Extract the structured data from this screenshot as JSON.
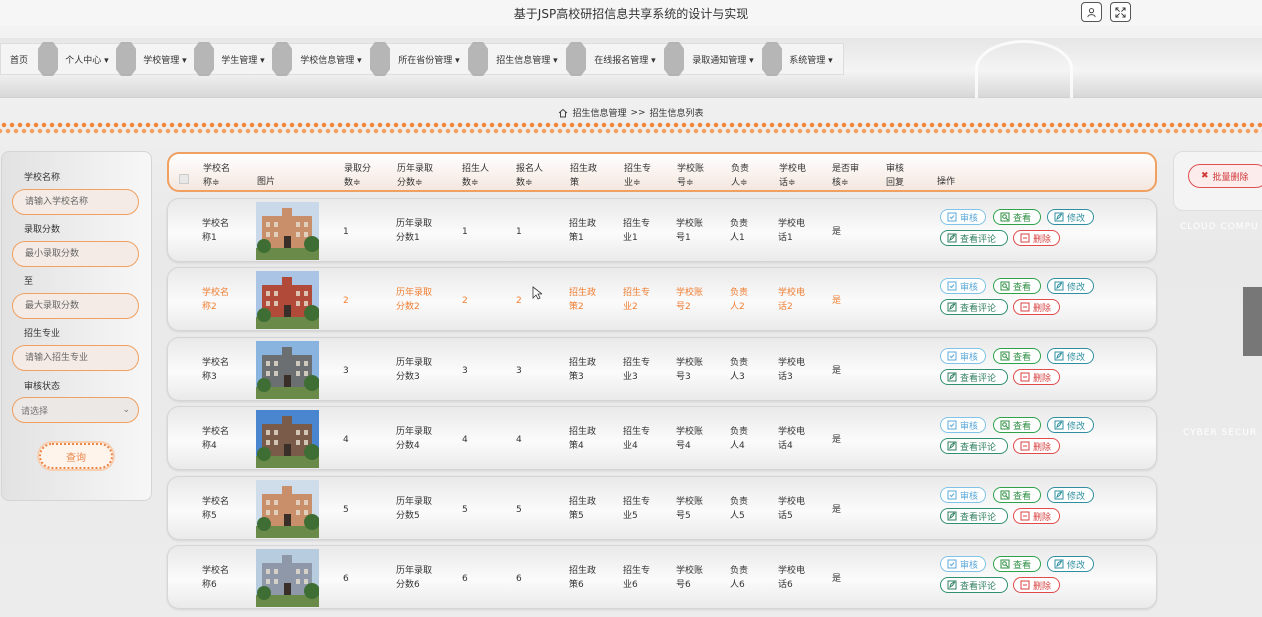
{
  "app": {
    "title": "基于JSP高校研招信息共享系统的设计与实现"
  },
  "nav": {
    "items": [
      {
        "label": "首页"
      },
      {
        "label": "个人中心 ▾"
      },
      {
        "label": "学校管理 ▾"
      },
      {
        "label": "学生管理 ▾"
      },
      {
        "label": "学校信息管理 ▾"
      },
      {
        "label": "所在省份管理 ▾"
      },
      {
        "label": "招生信息管理 ▾"
      },
      {
        "label": "在线报名管理 ▾"
      },
      {
        "label": "录取通知管理 ▾"
      },
      {
        "label": "系统管理 ▾"
      }
    ]
  },
  "breadcrumb": {
    "section": "招生信息管理",
    "sep": ">>",
    "page": "招生信息列表"
  },
  "search": {
    "school_label": "学校名称",
    "school_placeholder": "请输入学校名称",
    "score_label": "录取分数",
    "min_placeholder": "最小录取分数",
    "to_label": "至",
    "max_placeholder": "最大录取分数",
    "major_label": "招生专业",
    "major_placeholder": "请输入招生专业",
    "status_label": "审核状态",
    "status_value": "请选择",
    "query_button": "查询"
  },
  "batch_delete": "批量删除",
  "watermark": {
    "cloud": "CLOUD COMPU",
    "cyber": "CYBER SECUR"
  },
  "table": {
    "headers": {
      "school": "学校名\n称≑",
      "image": "图片",
      "score": "录取分\n数≑",
      "hist": "历年录取\n分数≑",
      "plan": "招生人\n数≑",
      "applied": "报名人\n数≑",
      "policy": "招生政\n策",
      "major": "招生专\n业≑",
      "account": "学校账\n号≑",
      "leader": "负责\n人≑",
      "phone": "学校电\n话≑",
      "audited": "是否审\n核≑",
      "reply": "审核\n回复",
      "ops": "操作"
    },
    "actions": {
      "audit": "审核",
      "view": "查看",
      "edit": "修改",
      "comments": "查看评论",
      "delete": "删除"
    },
    "rows": [
      {
        "school": "学校名\n称1",
        "score": "1",
        "hist": "历年录取\n分数1",
        "plan": "1",
        "applied": "1",
        "policy": "招生政\n策1",
        "major": "招生专\n业1",
        "account": "学校账\n号1",
        "leader": "负责\n人1",
        "phone": "学校电\n话1",
        "audited": "是"
      },
      {
        "school": "学校名\n称2",
        "score": "2",
        "hist": "历年录取\n分数2",
        "plan": "2",
        "applied": "2",
        "policy": "招生政\n策2",
        "major": "招生专\n业2",
        "account": "学校账\n号2",
        "leader": "负责\n人2",
        "phone": "学校电\n话2",
        "audited": "是"
      },
      {
        "school": "学校名\n称3",
        "score": "3",
        "hist": "历年录取\n分数3",
        "plan": "3",
        "applied": "3",
        "policy": "招生政\n策3",
        "major": "招生专\n业3",
        "account": "学校账\n号3",
        "leader": "负责\n人3",
        "phone": "学校电\n话3",
        "audited": "是"
      },
      {
        "school": "学校名\n称4",
        "score": "4",
        "hist": "历年录取\n分数4",
        "plan": "4",
        "applied": "4",
        "policy": "招生政\n策4",
        "major": "招生专\n业4",
        "account": "学校账\n号4",
        "leader": "负责\n人4",
        "phone": "学校电\n话4",
        "audited": "是"
      },
      {
        "school": "学校名\n称5",
        "score": "5",
        "hist": "历年录取\n分数5",
        "plan": "5",
        "applied": "5",
        "policy": "招生政\n策5",
        "major": "招生专\n业5",
        "account": "学校账\n号5",
        "leader": "负责\n人5",
        "phone": "学校电\n话5",
        "audited": "是"
      },
      {
        "school": "学校名\n称6",
        "score": "6",
        "hist": "历年录取\n分数6",
        "plan": "6",
        "applied": "6",
        "policy": "招生政\n策6",
        "major": "招生专\n业6",
        "account": "学校账\n号6",
        "leader": "负责\n人6",
        "phone": "学校电\n话6",
        "audited": "是"
      }
    ]
  },
  "colors": {
    "accent": "#f0843a",
    "audit": "#5aa8d8",
    "view": "#2c8f42",
    "edit": "#2f8f9f",
    "delete": "#d84040"
  }
}
